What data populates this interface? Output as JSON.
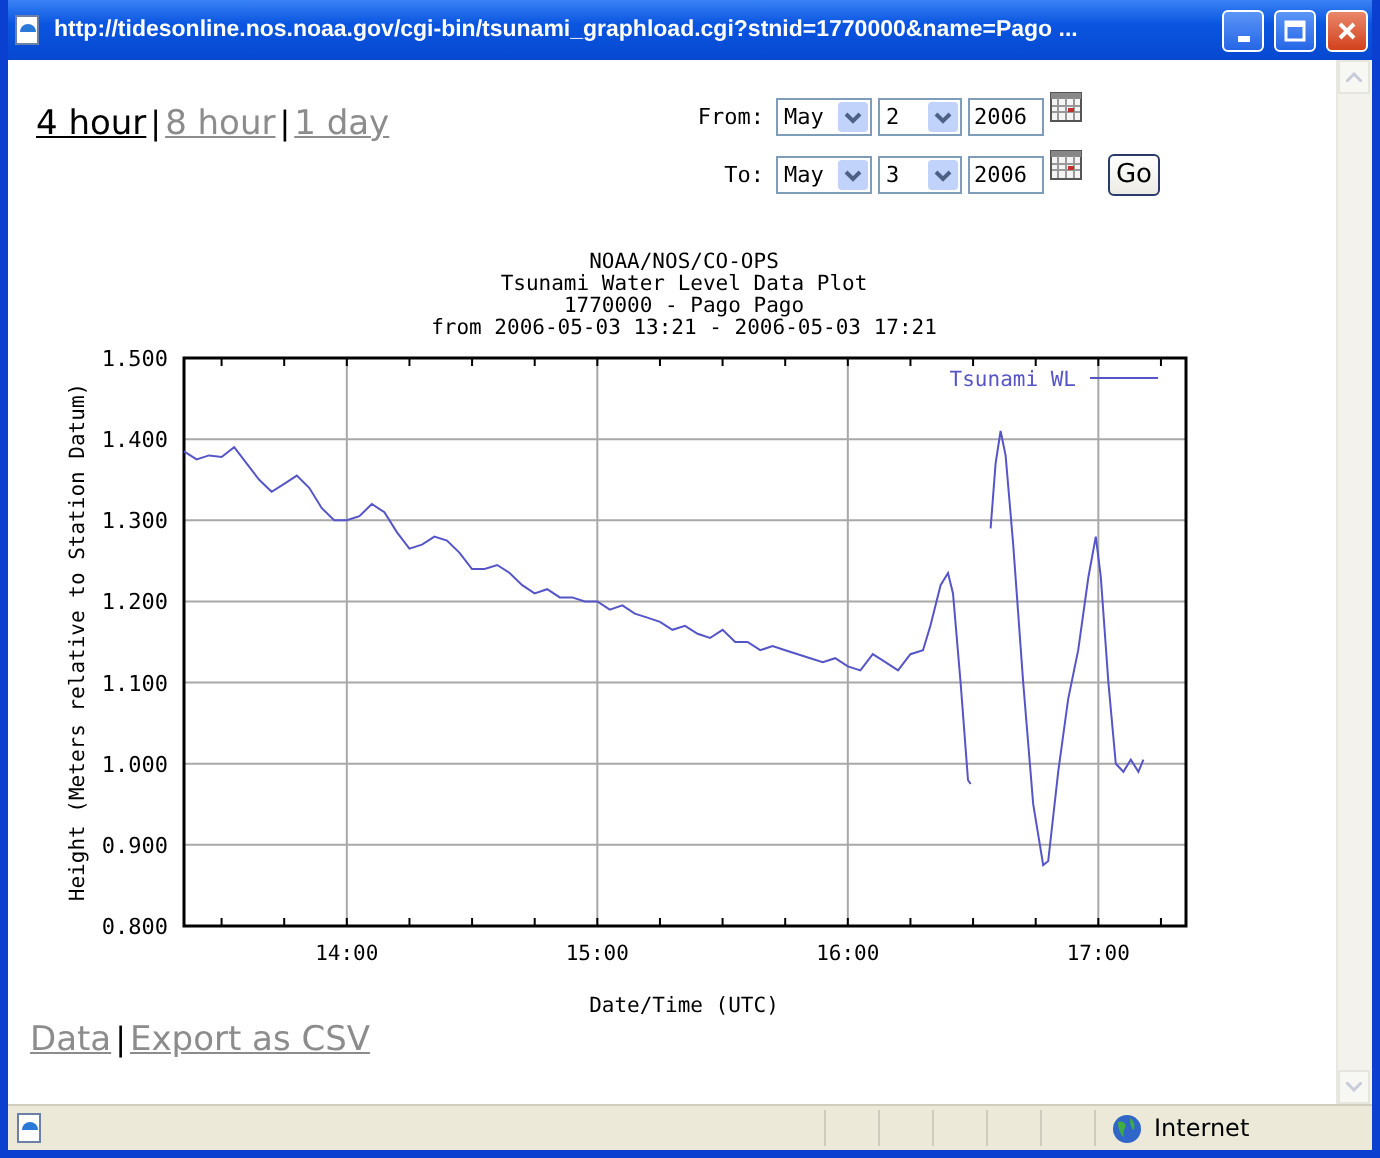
{
  "window": {
    "title": "http://tidesonline.nos.noaa.gov/cgi-bin/tsunami_graphload.cgi?stnid=1770000&name=Pago ..."
  },
  "range_links": [
    {
      "label": "4 hour",
      "selected": true
    },
    {
      "label": "8 hour",
      "selected": false
    },
    {
      "label": "1 day",
      "selected": false
    }
  ],
  "range_separators": [
    "|",
    "|"
  ],
  "date_form": {
    "rows": [
      {
        "label": "From:",
        "month": "May",
        "day": "2",
        "year": "2006"
      },
      {
        "label": "To:",
        "month": "May",
        "day": "3",
        "year": "2006"
      }
    ],
    "go_button": "Go"
  },
  "chart_header": [
    "NOAA/NOS/CO-OPS",
    "Tsunami Water Level Data Plot",
    "1770000 - Pago Pago",
    "from 2006-05-03 13:21 - 2006-05-03 17:21"
  ],
  "chart_data": {
    "type": "line",
    "grid": true,
    "xlabel": "Date/Time (UTC)",
    "ylabel": "Height (Meters relative to Station Datum)",
    "x": [
      13.35,
      13.4,
      13.45,
      13.5,
      13.55,
      13.6,
      13.65,
      13.7,
      13.75,
      13.8,
      13.85,
      13.9,
      13.95,
      14.0,
      14.05,
      14.1,
      14.15,
      14.2,
      14.25,
      14.3,
      14.35,
      14.4,
      14.45,
      14.5,
      14.55,
      14.6,
      14.65,
      14.7,
      14.75,
      14.8,
      14.85,
      14.9,
      14.95,
      15.0,
      15.05,
      15.1,
      15.15,
      15.2,
      15.25,
      15.3,
      15.35,
      15.4,
      15.45,
      15.5,
      15.55,
      15.6,
      15.65,
      15.7,
      15.75,
      15.8,
      15.85,
      15.9,
      15.95,
      16.0,
      16.05,
      16.1,
      16.15,
      16.2,
      16.25,
      16.3,
      16.33,
      16.37,
      16.4,
      16.42,
      16.45,
      16.48,
      16.49,
      16.52,
      16.57,
      16.59,
      16.61,
      16.63,
      16.66,
      16.7,
      16.74,
      16.78,
      16.8,
      16.84,
      16.88,
      16.92,
      16.96,
      16.99,
      17.01,
      17.04,
      17.07,
      17.1,
      17.13,
      17.16,
      17.18
    ],
    "series": [
      {
        "name": "Tsunami WL",
        "color": "#5555c8",
        "values": [
          1.385,
          1.375,
          1.38,
          1.378,
          1.39,
          1.37,
          1.35,
          1.335,
          1.345,
          1.355,
          1.34,
          1.315,
          1.3,
          1.3,
          1.305,
          1.32,
          1.31,
          1.285,
          1.265,
          1.27,
          1.28,
          1.275,
          1.26,
          1.24,
          1.24,
          1.245,
          1.235,
          1.22,
          1.21,
          1.215,
          1.205,
          1.205,
          1.2,
          1.2,
          1.19,
          1.195,
          1.185,
          1.18,
          1.175,
          1.165,
          1.17,
          1.16,
          1.155,
          1.165,
          1.15,
          1.15,
          1.14,
          1.145,
          1.14,
          1.135,
          1.13,
          1.125,
          1.13,
          1.12,
          1.115,
          1.135,
          1.125,
          1.115,
          1.135,
          1.14,
          1.17,
          1.22,
          1.235,
          1.21,
          1.1,
          0.98,
          0.975,
          null,
          1.29,
          1.37,
          1.41,
          1.38,
          1.27,
          1.1,
          0.95,
          0.875,
          0.88,
          0.99,
          1.08,
          1.14,
          1.23,
          1.28,
          1.23,
          1.1,
          1.0,
          0.99,
          1.005,
          0.99,
          1.005
        ]
      }
    ],
    "xlim": [
      13.35,
      17.35
    ],
    "ylim": [
      0.8,
      1.5
    ],
    "xticks": [
      {
        "value": 14,
        "label": "14:00"
      },
      {
        "value": 15,
        "label": "15:00"
      },
      {
        "value": 16,
        "label": "16:00"
      },
      {
        "value": 17,
        "label": "17:00"
      }
    ],
    "yticks": [
      {
        "value": 0.8,
        "label": "0.800"
      },
      {
        "value": 0.9,
        "label": "0.900"
      },
      {
        "value": 1.0,
        "label": "1.000"
      },
      {
        "value": 1.1,
        "label": "1.100"
      },
      {
        "value": 1.2,
        "label": "1.200"
      },
      {
        "value": 1.3,
        "label": "1.300"
      },
      {
        "value": 1.4,
        "label": "1.400"
      },
      {
        "value": 1.5,
        "label": "1.500"
      }
    ]
  },
  "bottom_links": [
    "Data",
    "Export as CSV"
  ],
  "bottom_separators": [
    "|"
  ],
  "status_bar": {
    "zone": "Internet"
  }
}
